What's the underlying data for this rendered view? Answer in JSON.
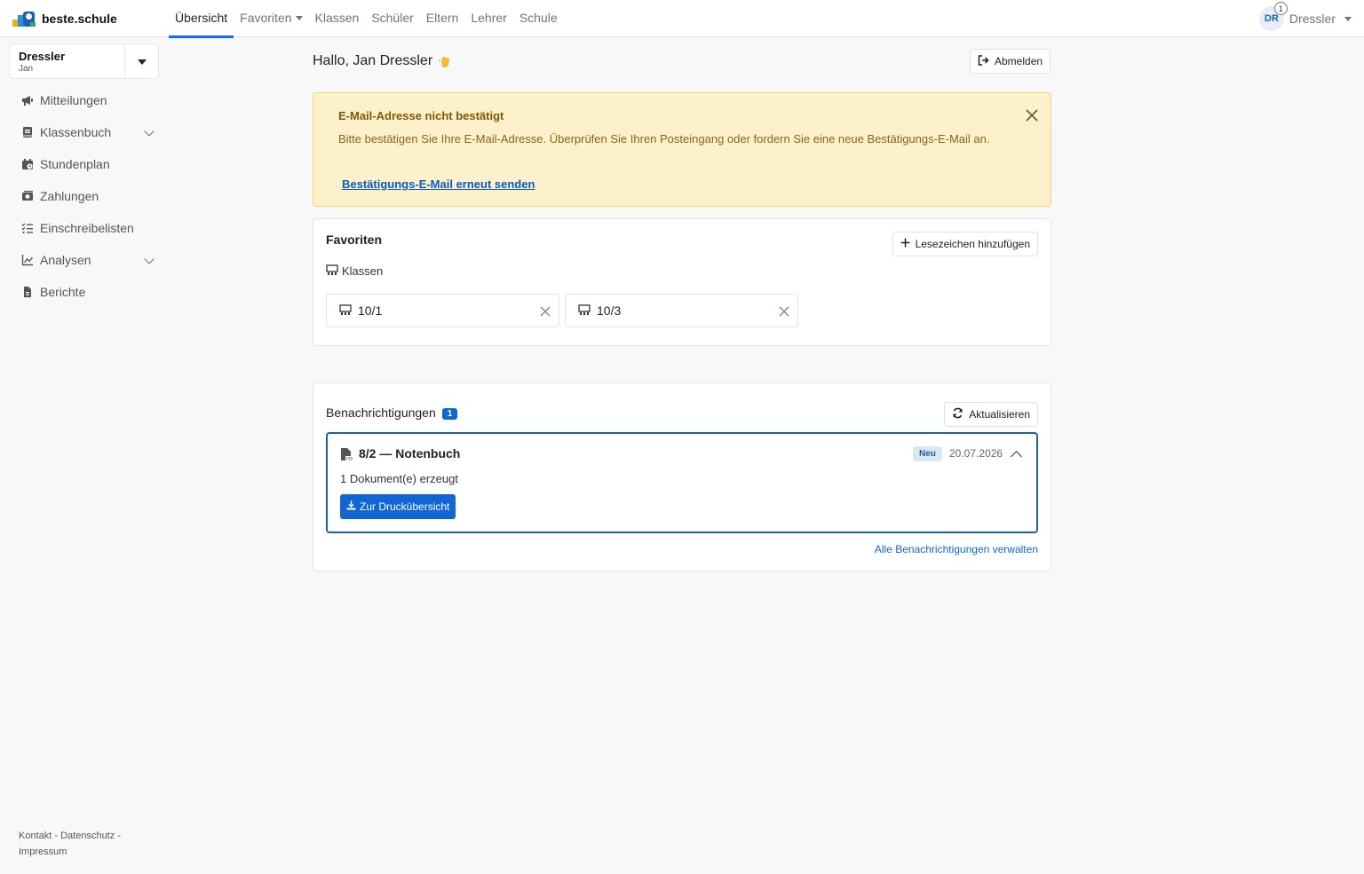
{
  "brand": {
    "name": "beste.schule"
  },
  "nav": {
    "items": [
      {
        "label": "Übersicht",
        "active": true
      },
      {
        "label": "Favoriten",
        "dropdown": true
      },
      {
        "label": "Klassen"
      },
      {
        "label": "Schüler"
      },
      {
        "label": "Eltern"
      },
      {
        "label": "Lehrer"
      },
      {
        "label": "Schule"
      }
    ]
  },
  "user": {
    "initials": "DR",
    "notification_count": "1",
    "name": "Dressler"
  },
  "profile": {
    "name": "Dressler",
    "sub": "Jan"
  },
  "sidebar": {
    "items": [
      {
        "label": "Mitteilungen",
        "icon": "megaphone-icon"
      },
      {
        "label": "Klassenbuch",
        "icon": "book-icon",
        "expandable": true
      },
      {
        "label": "Stundenplan",
        "icon": "calendar-icon"
      },
      {
        "label": "Zahlungen",
        "icon": "money-icon"
      },
      {
        "label": "Einschreibelisten",
        "icon": "list-check-icon"
      },
      {
        "label": "Analysen",
        "icon": "chart-line-icon",
        "expandable": true
      },
      {
        "label": "Berichte",
        "icon": "file-icon"
      }
    ]
  },
  "footer": {
    "kontakt": "Kontakt",
    "datenschutz": "Datenschutz",
    "impressum": "Impressum",
    "sep": " - "
  },
  "greeting": {
    "text": "Hallo, Jan Dressler"
  },
  "logout": {
    "label": "Abmelden"
  },
  "alert": {
    "title": "E-Mail-Adresse nicht bestätigt",
    "text": "Bitte bestätigen Sie Ihre E-Mail-Adresse. Überprüfen Sie Ihren Posteingang oder fordern Sie eine neue Bestätigungs-E-Mail an.",
    "link": "Bestätigungs-E-Mail erneut senden"
  },
  "favorites": {
    "title": "Favoriten",
    "add_label": "Lesezeichen hinzufügen",
    "group_label": "Klassen",
    "items": [
      {
        "label": "10/1"
      },
      {
        "label": "10/3"
      }
    ]
  },
  "notifications": {
    "title": "Benachrichtigungen",
    "count": "1",
    "refresh_label": "Aktualisieren",
    "item": {
      "title": "8/2 — Notenbuch",
      "badge": "Neu",
      "date": "20.07.2026",
      "description": "1 Dokument(e) erzeugt",
      "action_label": "Zur Druckübersicht"
    },
    "manage_label": "Alle Benachrichtigungen verwalten"
  },
  "colors": {
    "primary": "#1266d4",
    "alert_bg": "#fdf1cb",
    "alert_text": "#8a6514",
    "active_tab": "#0d6efd"
  }
}
